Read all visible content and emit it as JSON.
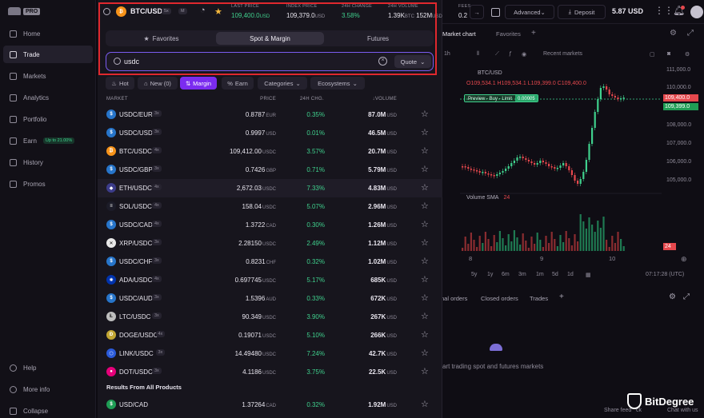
{
  "sidebar": {
    "logo_badge": "PRO",
    "items": [
      {
        "label": "Home",
        "icon": "home-icon",
        "active": false
      },
      {
        "label": "Trade",
        "icon": "trade-icon",
        "active": true
      },
      {
        "label": "Markets",
        "icon": "markets-icon",
        "active": false
      },
      {
        "label": "Analytics",
        "icon": "analytics-icon",
        "active": false
      },
      {
        "label": "Portfolio",
        "icon": "portfolio-icon",
        "active": false
      },
      {
        "label": "Earn",
        "icon": "earn-icon",
        "active": false,
        "badge": "Up to 21.00%"
      },
      {
        "label": "History",
        "icon": "history-icon",
        "active": false
      },
      {
        "label": "Promos",
        "icon": "promos-icon",
        "active": false
      }
    ],
    "bottom": [
      {
        "label": "Help",
        "icon": "help-icon"
      },
      {
        "label": "More info",
        "icon": "more-info-icon"
      },
      {
        "label": "Collapse",
        "icon": "collapse-icon"
      }
    ]
  },
  "ticker": {
    "pair": "BTC/USD",
    "leverage": "5x",
    "chip2": "M",
    "last_price_label": "LAST PRICE",
    "last_price": "109,400.0",
    "last_price_unit": "USD",
    "index_price_label": "INDEX PRICE",
    "index_price": "109,379.0",
    "index_price_unit": "USD",
    "change_label": "24H CHANGE",
    "change": "3.58%",
    "volume_label": "24H VOLUME",
    "volume_btc": "1.39K",
    "volume_btc_unit": "BTC",
    "volume_usd": "152M",
    "volume_usd_unit": "USD",
    "fees_label": "FEES",
    "fees": "0.2"
  },
  "topbar_right": {
    "mode": "Advanced",
    "deposit": "Deposit",
    "balance": "5.87",
    "balance_unit": "USD"
  },
  "market_tabs": [
    "Favorites",
    "Spot & Margin",
    "Futures"
  ],
  "search": {
    "value": "usdc",
    "placeholder": "Search",
    "quote_label": "Quote"
  },
  "filters": [
    "Hot",
    "New (0)",
    "Margin",
    "Earn",
    "Categories",
    "Ecosystems"
  ],
  "table": {
    "headers": [
      "MARKET",
      "PRICE",
      "24H CHG.",
      "VOLUME"
    ],
    "rows": [
      {
        "pair": "USDC/EUR",
        "lev": "3x",
        "price": "0.8787",
        "unit": "EUR",
        "chg": "0.35%",
        "vol": "87.0M",
        "vol_unit": "USD",
        "coin": "usdc"
      },
      {
        "pair": "USDC/USD",
        "lev": "3x",
        "price": "0.9997",
        "unit": "USD",
        "chg": "0.01%",
        "vol": "46.5M",
        "vol_unit": "USD",
        "coin": "usdc"
      },
      {
        "pair": "BTC/USDC",
        "lev": "4x",
        "price": "109,412.00",
        "unit": "USDC",
        "chg": "3.57%",
        "vol": "20.7M",
        "vol_unit": "USD",
        "coin": "btc"
      },
      {
        "pair": "USDC/GBP",
        "lev": "3x",
        "price": "0.7426",
        "unit": "GBP",
        "chg": "0.71%",
        "vol": "5.79M",
        "vol_unit": "USD",
        "coin": "usdc"
      },
      {
        "pair": "ETH/USDC",
        "lev": "4x",
        "price": "2,672.03",
        "unit": "USDC",
        "chg": "7.33%",
        "vol": "4.83M",
        "vol_unit": "USD",
        "coin": "eth",
        "hl": true
      },
      {
        "pair": "SOL/USDC",
        "lev": "4x",
        "price": "158.04",
        "unit": "USDC",
        "chg": "5.07%",
        "vol": "2.96M",
        "vol_unit": "USD",
        "coin": "sol"
      },
      {
        "pair": "USDC/CAD",
        "lev": "4x",
        "price": "1.3722",
        "unit": "CAD",
        "chg": "0.30%",
        "vol": "1.26M",
        "vol_unit": "USD",
        "coin": "usdc"
      },
      {
        "pair": "XRP/USDC",
        "lev": "3x",
        "price": "2.28150",
        "unit": "USDC",
        "chg": "2.49%",
        "vol": "1.12M",
        "vol_unit": "USD",
        "coin": "xrp"
      },
      {
        "pair": "USDC/CHF",
        "lev": "3x",
        "price": "0.8231",
        "unit": "CHF",
        "chg": "0.32%",
        "vol": "1.02M",
        "vol_unit": "USD",
        "coin": "usdc"
      },
      {
        "pair": "ADA/USDC",
        "lev": "4x",
        "price": "0.697745",
        "unit": "USDC",
        "chg": "5.17%",
        "vol": "685K",
        "vol_unit": "USD",
        "coin": "ada"
      },
      {
        "pair": "USDC/AUD",
        "lev": "3x",
        "price": "1.5396",
        "unit": "AUD",
        "chg": "0.33%",
        "vol": "672K",
        "vol_unit": "USD",
        "coin": "usdc"
      },
      {
        "pair": "LTC/USDC",
        "lev": "3x",
        "price": "90.349",
        "unit": "USDC",
        "chg": "3.90%",
        "vol": "267K",
        "vol_unit": "USD",
        "coin": "ltc"
      },
      {
        "pair": "DOGE/USDC",
        "lev": "4x",
        "price": "0.19071",
        "unit": "USDC",
        "chg": "5.10%",
        "vol": "266K",
        "vol_unit": "USD",
        "coin": "doge"
      },
      {
        "pair": "LINK/USDC",
        "lev": "3x",
        "price": "14.49480",
        "unit": "USDC",
        "chg": "7.24%",
        "vol": "42.7K",
        "vol_unit": "USD",
        "coin": "link"
      },
      {
        "pair": "DOT/USDC",
        "lev": "3x",
        "price": "4.1186",
        "unit": "USDC",
        "chg": "3.75%",
        "vol": "22.5K",
        "vol_unit": "USD",
        "coin": "dot"
      }
    ],
    "section_title": "Results From All Products",
    "extra_row": {
      "pair": "USD/CAD",
      "price": "1.37264",
      "unit": "CAD",
      "chg": "0.32%",
      "vol": "1.92M",
      "vol_unit": "USD",
      "coin": "usd"
    }
  },
  "coin_colors": {
    "usdc": "#2775ca",
    "btc": "#f7931a",
    "eth": "#3c3c8a",
    "sol": "#1c1c28",
    "xrp": "#e8e8e8",
    "ada": "#0033ad",
    "ltc": "#bebebe",
    "doge": "#c2a633",
    "link": "#2a5ada",
    "dot": "#e6007a",
    "usd": "#1f9d55"
  },
  "chart_panel": {
    "tabs": [
      "Market chart",
      "Favorites"
    ],
    "pair": "BTC/USD",
    "interval": "1h",
    "recent_markets": "Recent markets",
    "ohlc": "O109,534.1  H109,534.1  L109,399.0  C109,400.0",
    "preview": "Preview - Buy - Limit",
    "preview_val": "0.00005",
    "y_ticks": [
      "111,000.0",
      "110,000.0",
      "108,000.0",
      "107,000.0",
      "106,000.0",
      "105,000.0"
    ],
    "price_last": "109,400.0",
    "price_index": "109,399.0",
    "volume_label": "Volume SMA",
    "volume_value": "24",
    "volume_tag": "24",
    "x_ticks": [
      "8",
      "9",
      "10"
    ],
    "ranges": [
      "5y",
      "1y",
      "6m",
      "3m",
      "1m",
      "5d",
      "1d"
    ],
    "time": "07:17:28 (UTC)",
    "bottom_tabs": [
      "nal orders",
      "Closed orders",
      "Trades"
    ],
    "empty_text": "art trading spot and futures markets",
    "footer_left": "Share feed",
    "footer_mid": "ck",
    "footer_right": "Chat with us",
    "watermark": "BitDegree"
  }
}
